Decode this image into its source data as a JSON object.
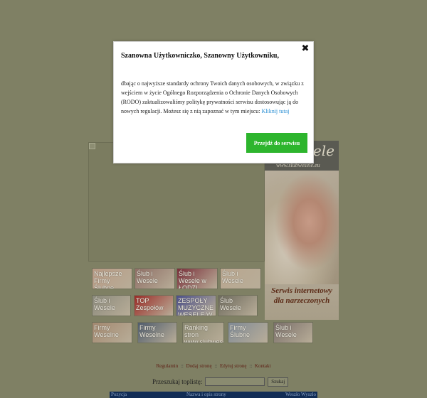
{
  "modal": {
    "title": "Szanowna Użytkowniczko, Szanowny Użytkowniku,",
    "close_glyph": "✖",
    "body_text": "dbając o najwyższe standardy ochrony Twoich danych osobowych, w związku z wejściem w życie Ogólnego Rozporządzenia o Ochronie Danych Osobowych (RODO) zaktualizowaliśmy politykę prywatności serwisu dostosowując ją do nowych regulacji. Możesz się z nią zapoznać w tym miejscu: ",
    "link_text": "Kliknij tutaj",
    "button_label": "Przejdź do serwisu",
    "button_color": "#2db52d",
    "link_color": "#2a8fd4"
  },
  "side_banner": {
    "title": "Wesele",
    "url": "www.slubwesele.eu",
    "caption_line1": "Serwis internetowy",
    "caption_line2": "dla narzeczonych"
  },
  "thumbnails": [
    {
      "label": "Najlepsze Firmy Ślubne",
      "color": "#b89a84"
    },
    {
      "label": "Ślub i Wesele",
      "color": "#8f6f66"
    },
    {
      "label": "Ślub i Wesele w ŁODZI",
      "color": "#7a2f3a"
    },
    {
      "label": "Ślub i Wesele",
      "color": "#b9a68f"
    },
    {
      "label": "Ślub i Wesele",
      "color": "#8b8a7c"
    },
    {
      "label": "TOP Zespołów",
      "color": "#9a2b26"
    },
    {
      "label": "ZESPOŁY MUZYCZNE WESELE W ŁODZI",
      "color": "#4b4f8a"
    },
    {
      "label": "Ślub Wesele",
      "color": "#6d6a5d"
    },
    {
      "label": "Firmy Weselne",
      "color": "#a3886f"
    },
    {
      "label": "Firmy Weselne",
      "color": "#4f5c6c"
    },
    {
      "label": "Ranking stron www.slubwesele.com",
      "color": "#8c8a73"
    },
    {
      "label": "Firmy Ślubne",
      "color": "#7f8a96"
    },
    {
      "label": "Ślub i Wesele",
      "color": "#7a6f6a"
    }
  ],
  "footer": {
    "links": [
      "Regulamin",
      "Dodaj stronę",
      "Edytuj stronę",
      "Kontakt"
    ],
    "separator": "::"
  },
  "search": {
    "label": "Przeszukaj toplistę:",
    "value": "",
    "button_label": "Szukaj"
  },
  "table": {
    "col_position": "Pozycja",
    "col_name": "Nazwa i opis strony",
    "col_in_out": "Weszło Wyszło"
  }
}
